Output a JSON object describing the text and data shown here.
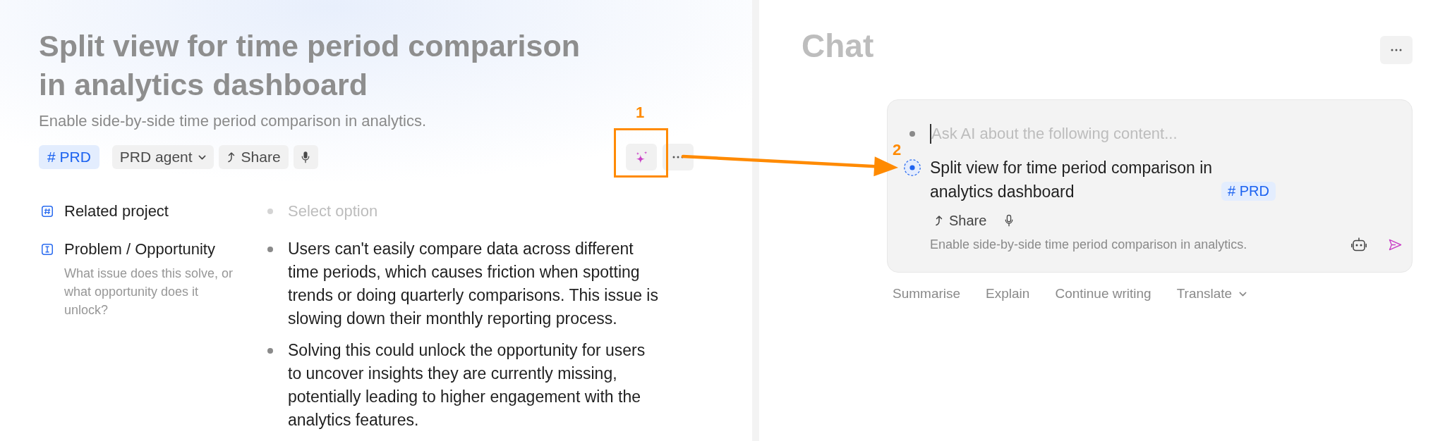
{
  "document": {
    "title": "Split view for time period comparison in analytics dashboard",
    "subtitle": "Enable side-by-side time period comparison in analytics.",
    "tag": "# PRD",
    "toolbar": [
      {
        "kind": "dropdown",
        "label": "PRD agent"
      },
      {
        "kind": "share",
        "label": "Share"
      },
      {
        "kind": "voice"
      }
    ],
    "fields": [
      {
        "kind": "relation",
        "label": "Related project",
        "placeholder": "Select option"
      },
      {
        "kind": "text",
        "label": "Problem / Opportunity",
        "hint": "What issue does this solve, or what opportunity does it unlock?",
        "bullets": [
          "Users can't easily compare data across different time periods, which causes friction when spotting trends or doing quarterly comparisons. This issue is slowing down their monthly reporting process.",
          "Solving this could unlock the opportunity for users to uncover insights they are currently missing, potentially leading to higher engagement with the analytics features."
        ]
      }
    ]
  },
  "chat": {
    "title": "Chat",
    "input": {
      "placeholder": "Ask AI about the following content...",
      "focused": true
    },
    "context": {
      "title": "Split view for time period comparison in analytics dashboard",
      "tag": "# PRD",
      "share": "Share",
      "description": "Enable side-by-side time period comparison in analytics."
    },
    "suggestions": [
      {
        "kind": "action",
        "label": "Summarise"
      },
      {
        "kind": "action",
        "label": "Explain"
      },
      {
        "kind": "action",
        "label": "Continue writing"
      },
      {
        "kind": "menu",
        "label": "Translate"
      }
    ]
  },
  "annotations": [
    {
      "kind": "box",
      "label": "1"
    },
    {
      "kind": "arrow",
      "label": "2"
    }
  ]
}
